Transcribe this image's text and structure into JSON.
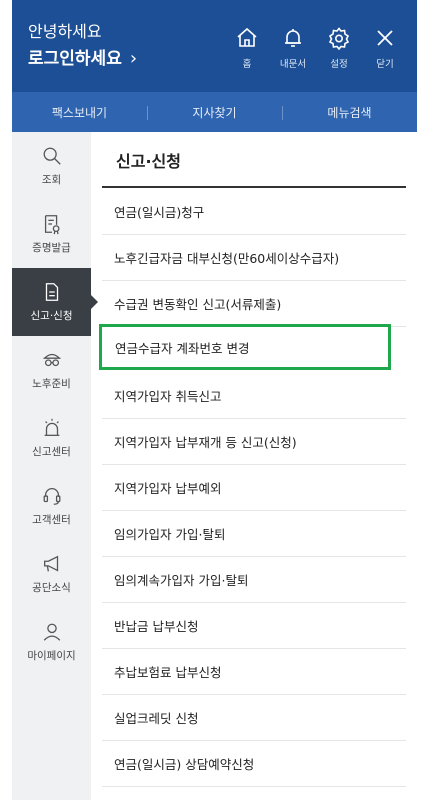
{
  "header": {
    "greeting": "안녕하세요",
    "login_label": "로그인하세요",
    "login_chevron": "›",
    "icons": [
      {
        "name": "home-icon",
        "label": "홈"
      },
      {
        "name": "bell-icon",
        "label": "내문서"
      },
      {
        "name": "gear-icon",
        "label": "설정"
      },
      {
        "name": "close-icon",
        "label": "닫기"
      }
    ],
    "bg_color": "#1d4f96"
  },
  "quickbar": {
    "items": [
      "팩스보내기",
      "지사찾기",
      "메뉴검색"
    ],
    "bg_color": "#2e64b0"
  },
  "sidebar": {
    "items": [
      {
        "icon": "search-icon",
        "label": "조회",
        "active": false
      },
      {
        "icon": "certificate-icon",
        "label": "증명발급",
        "active": false
      },
      {
        "icon": "document-icon",
        "label": "신고·신청",
        "active": true
      },
      {
        "icon": "retirement-icon",
        "label": "노후준비",
        "active": false
      },
      {
        "icon": "report-center-icon",
        "label": "신고센터",
        "active": false
      },
      {
        "icon": "headset-icon",
        "label": "고객센터",
        "active": false
      },
      {
        "icon": "megaphone-icon",
        "label": "공단소식",
        "active": false
      },
      {
        "icon": "user-icon",
        "label": "마이페이지",
        "active": false
      }
    ]
  },
  "main": {
    "title": "신고·신청",
    "items": [
      "연금(일시금)청구",
      "노후긴급자금 대부신청(만60세이상수급자)",
      "수급권 변동확인 신고(서류제출)",
      "연금수급자 계좌번호 변경",
      "지역가입자 취득신고",
      "지역가입자 납부재개 등 신고(신청)",
      "지역가입자 납부예외",
      "임의가입자 가입·탈퇴",
      "임의계속가입자 가입·탈퇴",
      "반납금 납부신청",
      "추납보험료 납부신청",
      "실업크레딧 신청",
      "연금(일시금) 상담예약신청"
    ],
    "highlighted_item": "연금수급자 계좌번호 변경",
    "highlight_color": "#1fa84b"
  }
}
